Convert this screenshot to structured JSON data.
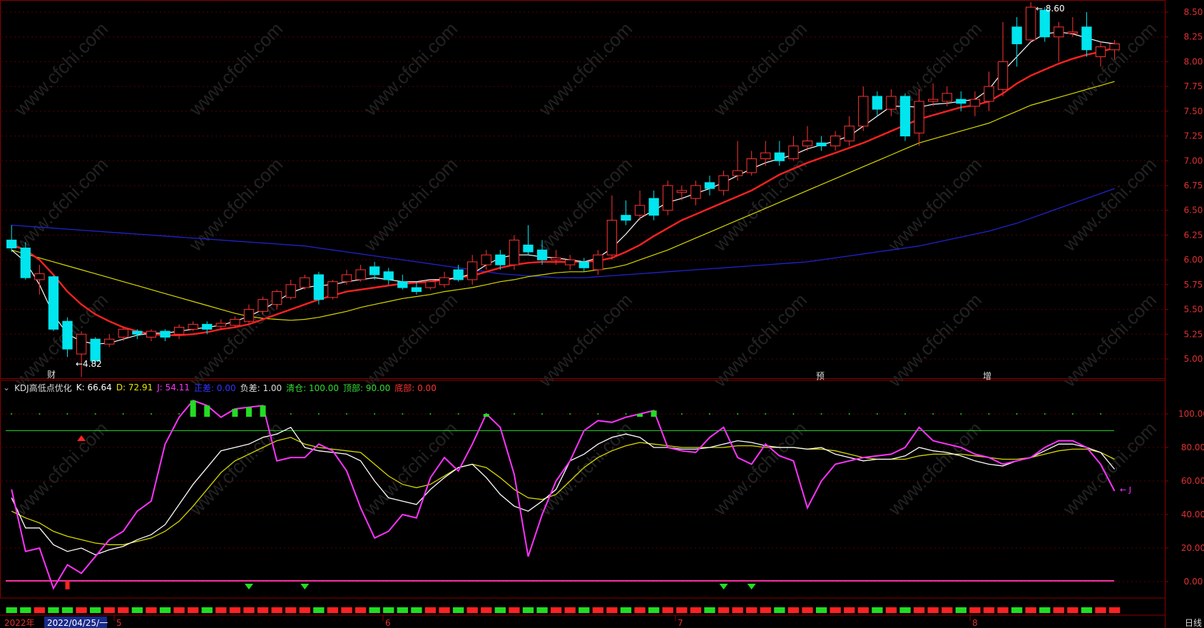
{
  "indicator": {
    "name": "KDJ高低点优化",
    "k": "K: 66.64",
    "d": "D: 72.91",
    "j": "J: 54.11",
    "zc": "正差: 0.00",
    "fc": "负差: 1.00",
    "qc": "清仓: 100.00",
    "db": "顶部: 90.00",
    "dib": "底部: 0.00"
  },
  "price_axis": [
    "8.50",
    "8.25",
    "8.00",
    "7.75",
    "7.50",
    "7.25",
    "7.00",
    "6.75",
    "6.50",
    "6.25",
    "6.00",
    "5.75",
    "5.50",
    "5.25",
    "5.00"
  ],
  "ind_axis": [
    "100.00",
    "80.00",
    "60.00",
    "40.00",
    "20.00",
    "0.00"
  ],
  "time_axis": {
    "year": "2022年",
    "date": "2022/04/25/一",
    "m5": "5",
    "m6": "6",
    "m7": "7",
    "m8": "8",
    "period": "日线"
  },
  "annotations": {
    "high": "8.60",
    "low": "←4.82",
    "cai": "财",
    "yu": "预",
    "zeng": "增",
    "jtag": "← J"
  },
  "watermark": "www.cfchi.com",
  "colors": {
    "up": "#ff3333",
    "down": "#00e5ee",
    "ma5": "#ffffff",
    "ma10": "#ff2222",
    "ma20": "#d8d800",
    "ma60": "#2222cc",
    "k": "#ffffff",
    "d": "#d8d800",
    "j": "#ff33ff"
  },
  "chart_data": {
    "type": "candlestick",
    "ylim": [
      4.75,
      8.65
    ],
    "candles": [
      [
        6.2,
        6.12,
        6.35,
        6.08
      ],
      [
        6.12,
        5.82,
        6.18,
        5.8
      ],
      [
        5.8,
        5.86,
        5.95,
        5.65
      ],
      [
        5.83,
        5.3,
        5.84,
        5.28
      ],
      [
        5.38,
        5.1,
        5.42,
        5.02
      ],
      [
        5.05,
        5.25,
        5.28,
        4.82
      ],
      [
        5.2,
        4.98,
        5.22,
        4.95
      ],
      [
        5.15,
        5.2,
        5.25,
        5.12
      ],
      [
        5.22,
        5.3,
        5.33,
        5.18
      ],
      [
        5.28,
        5.25,
        5.3,
        5.2
      ],
      [
        5.22,
        5.28,
        5.3,
        5.18
      ],
      [
        5.28,
        5.22,
        5.3,
        5.18
      ],
      [
        5.25,
        5.32,
        5.35,
        5.2
      ],
      [
        5.3,
        5.35,
        5.38,
        5.28
      ],
      [
        5.35,
        5.3,
        5.38,
        5.25
      ],
      [
        5.33,
        5.36,
        5.4,
        5.3
      ],
      [
        5.34,
        5.4,
        5.43,
        5.32
      ],
      [
        5.38,
        5.5,
        5.55,
        5.36
      ],
      [
        5.48,
        5.6,
        5.63,
        5.45
      ],
      [
        5.55,
        5.68,
        5.7,
        5.5
      ],
      [
        5.62,
        5.75,
        5.8,
        5.6
      ],
      [
        5.72,
        5.82,
        5.85,
        5.7
      ],
      [
        5.85,
        5.6,
        5.88,
        5.55
      ],
      [
        5.62,
        5.78,
        5.8,
        5.6
      ],
      [
        5.78,
        5.85,
        5.9,
        5.75
      ],
      [
        5.8,
        5.9,
        5.95,
        5.78
      ],
      [
        5.93,
        5.85,
        5.98,
        5.8
      ],
      [
        5.88,
        5.8,
        5.92,
        5.75
      ],
      [
        5.78,
        5.72,
        5.85,
        5.7
      ],
      [
        5.72,
        5.68,
        5.78,
        5.65
      ],
      [
        5.72,
        5.78,
        5.8,
        5.7
      ],
      [
        5.75,
        5.82,
        5.88,
        5.72
      ],
      [
        5.9,
        5.8,
        5.95,
        5.78
      ],
      [
        5.8,
        5.98,
        6.05,
        5.75
      ],
      [
        5.95,
        6.05,
        6.1,
        5.9
      ],
      [
        6.05,
        5.95,
        6.1,
        5.9
      ],
      [
        5.95,
        6.2,
        6.25,
        5.9
      ],
      [
        6.15,
        6.08,
        6.35,
        6.05
      ],
      [
        6.1,
        6.0,
        6.2,
        5.95
      ],
      [
        6.0,
        6.02,
        6.1,
        5.95
      ],
      [
        5.95,
        6.0,
        6.05,
        5.9
      ],
      [
        5.98,
        5.92,
        6.02,
        5.88
      ],
      [
        5.9,
        6.05,
        6.1,
        5.85
      ],
      [
        6.05,
        6.4,
        6.65,
        6.0
      ],
      [
        6.45,
        6.4,
        6.6,
        6.35
      ],
      [
        6.45,
        6.55,
        6.7,
        6.4
      ],
      [
        6.62,
        6.45,
        6.7,
        6.4
      ],
      [
        6.5,
        6.75,
        6.8,
        6.45
      ],
      [
        6.68,
        6.7,
        6.75,
        6.6
      ],
      [
        6.62,
        6.75,
        6.8,
        6.55
      ],
      [
        6.78,
        6.72,
        6.85,
        6.65
      ],
      [
        6.7,
        6.85,
        6.9,
        6.65
      ],
      [
        6.85,
        6.9,
        7.2,
        6.8
      ],
      [
        6.88,
        7.02,
        7.1,
        6.85
      ],
      [
        7.02,
        7.08,
        7.2,
        6.95
      ],
      [
        7.08,
        7.0,
        7.2,
        6.95
      ],
      [
        7.02,
        7.15,
        7.25,
        7.0
      ],
      [
        7.15,
        7.2,
        7.35,
        7.1
      ],
      [
        7.18,
        7.15,
        7.25,
        7.1
      ],
      [
        7.15,
        7.25,
        7.3,
        7.1
      ],
      [
        7.2,
        7.35,
        7.45,
        7.15
      ],
      [
        7.35,
        7.65,
        7.75,
        7.3
      ],
      [
        7.65,
        7.52,
        7.7,
        7.45
      ],
      [
        7.52,
        7.65,
        7.72,
        7.45
      ],
      [
        7.65,
        7.25,
        7.68,
        7.2
      ],
      [
        7.28,
        7.6,
        7.72,
        7.15
      ],
      [
        7.6,
        7.62,
        7.78,
        7.55
      ],
      [
        7.6,
        7.68,
        7.75,
        7.55
      ],
      [
        7.62,
        7.58,
        7.7,
        7.5
      ],
      [
        7.55,
        7.62,
        7.7,
        7.45
      ],
      [
        7.6,
        7.75,
        7.9,
        7.5
      ],
      [
        7.72,
        8.0,
        8.4,
        7.65
      ],
      [
        8.35,
        8.18,
        8.45,
        7.95
      ],
      [
        8.22,
        8.55,
        8.6,
        8.2
      ],
      [
        8.52,
        8.25,
        8.55,
        8.2
      ],
      [
        8.25,
        8.35,
        8.4,
        8.0
      ],
      [
        8.3,
        8.3,
        8.45,
        8.25
      ],
      [
        8.35,
        8.12,
        8.5,
        8.05
      ],
      [
        8.05,
        8.15,
        8.2,
        7.95
      ],
      [
        8.12,
        8.18,
        8.22,
        8.02
      ]
    ],
    "ma5": [
      6.1,
      5.98,
      5.75,
      5.45,
      5.25,
      5.18,
      5.15,
      5.16,
      5.2,
      5.24,
      5.26,
      5.26,
      5.28,
      5.3,
      5.32,
      5.34,
      5.38,
      5.43,
      5.5,
      5.58,
      5.67,
      5.72,
      5.74,
      5.75,
      5.78,
      5.8,
      5.82,
      5.8,
      5.78,
      5.78,
      5.8,
      5.8,
      5.82,
      5.86,
      5.95,
      6.02,
      6.05,
      6.05,
      6.03,
      6.02,
      6.0,
      5.98,
      6.02,
      6.12,
      6.26,
      6.42,
      6.5,
      6.58,
      6.62,
      6.67,
      6.72,
      6.78,
      6.85,
      6.92,
      6.98,
      7.02,
      7.06,
      7.12,
      7.16,
      7.2,
      7.25,
      7.35,
      7.45,
      7.55,
      7.55,
      7.54,
      7.57,
      7.58,
      7.6,
      7.62,
      7.72,
      7.9,
      8.05,
      8.2,
      8.28,
      8.3,
      8.28,
      8.24,
      8.2,
      8.18
    ],
    "ma10": [
      6.15,
      6.1,
      6.0,
      5.85,
      5.68,
      5.55,
      5.45,
      5.38,
      5.32,
      5.28,
      5.25,
      5.24,
      5.24,
      5.25,
      5.27,
      5.3,
      5.32,
      5.35,
      5.4,
      5.45,
      5.5,
      5.55,
      5.6,
      5.64,
      5.68,
      5.7,
      5.72,
      5.74,
      5.76,
      5.77,
      5.78,
      5.8,
      5.82,
      5.84,
      5.88,
      5.92,
      5.95,
      5.97,
      5.98,
      5.98,
      5.98,
      5.98,
      5.99,
      6.02,
      6.08,
      6.15,
      6.24,
      6.32,
      6.4,
      6.46,
      6.52,
      6.58,
      6.64,
      6.7,
      6.78,
      6.86,
      6.92,
      6.98,
      7.03,
      7.08,
      7.13,
      7.18,
      7.24,
      7.3,
      7.36,
      7.42,
      7.46,
      7.5,
      7.54,
      7.56,
      7.6,
      7.68,
      7.78,
      7.86,
      7.92,
      7.98,
      8.03,
      8.07,
      8.1,
      8.14
    ],
    "ma20": [
      6.1,
      6.06,
      6.02,
      5.98,
      5.94,
      5.9,
      5.86,
      5.82,
      5.78,
      5.74,
      5.7,
      5.66,
      5.62,
      5.58,
      5.54,
      5.5,
      5.46,
      5.43,
      5.41,
      5.4,
      5.39,
      5.4,
      5.42,
      5.45,
      5.48,
      5.52,
      5.55,
      5.58,
      5.61,
      5.63,
      5.65,
      5.68,
      5.7,
      5.72,
      5.75,
      5.78,
      5.8,
      5.83,
      5.85,
      5.87,
      5.88,
      5.88,
      5.9,
      5.92,
      5.95,
      6.0,
      6.05,
      6.1,
      6.16,
      6.22,
      6.28,
      6.34,
      6.4,
      6.46,
      6.52,
      6.58,
      6.64,
      6.7,
      6.76,
      6.82,
      6.88,
      6.94,
      7.0,
      7.06,
      7.12,
      7.18,
      7.22,
      7.26,
      7.3,
      7.34,
      7.38,
      7.44,
      7.5,
      7.56,
      7.6,
      7.64,
      7.68,
      7.72,
      7.76,
      7.8
    ],
    "ma60": [
      6.35,
      6.34,
      6.33,
      6.32,
      6.31,
      6.3,
      6.29,
      6.28,
      6.27,
      6.26,
      6.25,
      6.24,
      6.23,
      6.22,
      6.21,
      6.2,
      6.19,
      6.18,
      6.17,
      6.16,
      6.15,
      6.14,
      6.12,
      6.1,
      6.08,
      6.06,
      6.04,
      6.02,
      6.0,
      5.98,
      5.96,
      5.94,
      5.92,
      5.9,
      5.88,
      5.86,
      5.85,
      5.84,
      5.83,
      5.82,
      5.82,
      5.82,
      5.83,
      5.84,
      5.85,
      5.86,
      5.87,
      5.88,
      5.89,
      5.9,
      5.91,
      5.92,
      5.93,
      5.94,
      5.95,
      5.96,
      5.97,
      5.98,
      6.0,
      6.02,
      6.04,
      6.06,
      6.08,
      6.1,
      6.12,
      6.14,
      6.17,
      6.2,
      6.23,
      6.26,
      6.29,
      6.33,
      6.37,
      6.42,
      6.47,
      6.52,
      6.57,
      6.62,
      6.67,
      6.72
    ],
    "kdj_ylim": [
      -5,
      115
    ],
    "k": [
      50,
      32,
      32,
      22,
      18,
      20,
      16,
      19,
      21,
      25,
      28,
      34,
      46,
      58,
      68,
      78,
      80,
      82,
      86,
      88,
      92,
      80,
      78,
      77,
      76,
      72,
      60,
      50,
      48,
      46,
      55,
      62,
      68,
      70,
      62,
      52,
      45,
      42,
      48,
      55,
      72,
      76,
      82,
      86,
      88,
      86,
      80,
      80,
      79,
      79,
      80,
      82,
      84,
      83,
      81,
      80,
      80,
      79,
      80,
      76,
      74,
      72,
      73,
      73,
      75,
      80,
      78,
      77,
      75,
      72,
      70,
      69,
      72,
      74,
      78,
      82,
      82,
      80,
      77,
      67
    ],
    "d": [
      42,
      38,
      35,
      30,
      27,
      25,
      23,
      22,
      22,
      24,
      26,
      30,
      36,
      45,
      55,
      65,
      72,
      76,
      80,
      84,
      86,
      82,
      80,
      79,
      78,
      77,
      70,
      63,
      58,
      56,
      58,
      63,
      68,
      70,
      68,
      62,
      55,
      50,
      49,
      52,
      60,
      68,
      74,
      78,
      81,
      83,
      82,
      81,
      80,
      80,
      80,
      80,
      81,
      81,
      80,
      80,
      80,
      79,
      79,
      78,
      76,
      74,
      73,
      73,
      73,
      75,
      76,
      76,
      76,
      75,
      74,
      73,
      73,
      74,
      76,
      78,
      79,
      79,
      77,
      73
    ],
    "j": [
      55,
      18,
      20,
      -4,
      10,
      5,
      15,
      25,
      30,
      42,
      48,
      82,
      98,
      108,
      105,
      98,
      103,
      104,
      105,
      72,
      74,
      74,
      82,
      78,
      66,
      44,
      26,
      30,
      40,
      38,
      62,
      74,
      66,
      82,
      100,
      92,
      64,
      15,
      40,
      60,
      72,
      90,
      96,
      95,
      98,
      100,
      102,
      80,
      78,
      77,
      86,
      92,
      74,
      70,
      82,
      75,
      72,
      44,
      60,
      70,
      72,
      74,
      75,
      76,
      80,
      92,
      84,
      82,
      80,
      76,
      74,
      70,
      72,
      74,
      80,
      84,
      84,
      80,
      70,
      54
    ]
  }
}
